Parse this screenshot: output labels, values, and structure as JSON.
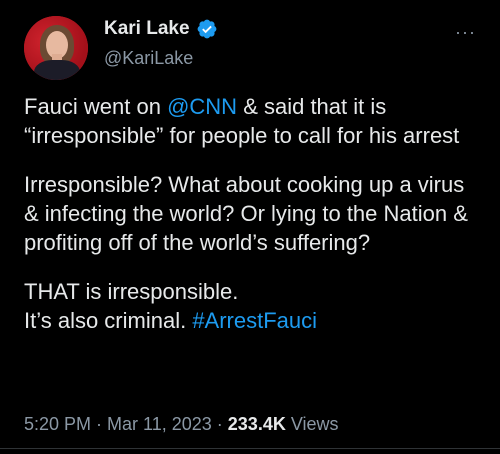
{
  "author": {
    "name": "Kari Lake",
    "handle": "@KariLake",
    "verified": true,
    "verified_color": "#1d9bf0"
  },
  "menu": {
    "label": "···",
    "icon": "more-icon"
  },
  "tweet": {
    "p1_a": "Fauci went on ",
    "p1_mention": "@CNN",
    "p1_b": " & said that it is “irresponsible” for people to call for his arrest",
    "p2": "Irresponsible? What about cooking up a virus & infecting the world? Or lying to the Nation & profiting off of the world’s suffering?",
    "p3_line1": "THAT is irresponsible.",
    "p3_line2": "It’s also criminal. ",
    "p3_hashtag": "#ArrestFauci"
  },
  "meta": {
    "time": "5:20 PM",
    "sep1": " · ",
    "date": "Mar 11, 2023",
    "sep2": " · ",
    "views_count": "233.4K",
    "views_label": " Views"
  },
  "colors": {
    "background": "#000000",
    "text": "#e7e9ea",
    "secondary": "#8b98a5",
    "link": "#1d9bf0"
  }
}
